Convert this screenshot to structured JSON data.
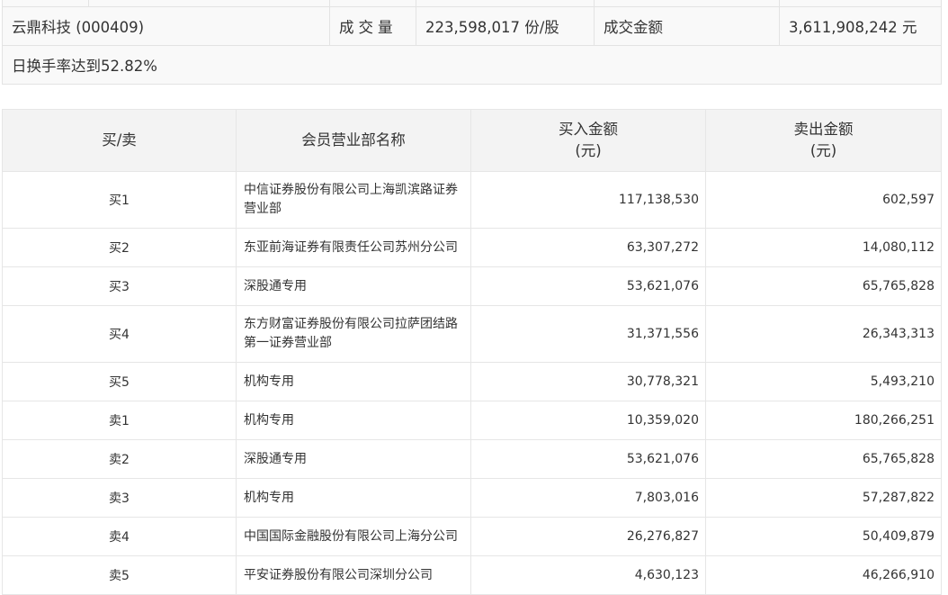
{
  "summary": {
    "stock": "云鼎科技 (000409)",
    "volume_label": "成交量",
    "volume_value": "223,598,017 份/股",
    "amount_label": "成交金额",
    "amount_value": "3,611,908,242 元",
    "note": "日换手率达到52.82%"
  },
  "detail": {
    "headers": {
      "side": "买/卖",
      "name": "会员营业部名称",
      "buy": "买入金额",
      "buy_unit": "(元)",
      "sell": "卖出金额",
      "sell_unit": "(元)"
    },
    "rows": [
      {
        "side": "买1",
        "name": "中信证券股份有限公司上海凯滨路证券营业部",
        "buy": "117,138,530",
        "sell": "602,597"
      },
      {
        "side": "买2",
        "name": "东亚前海证券有限责任公司苏州分公司",
        "buy": "63,307,272",
        "sell": "14,080,112"
      },
      {
        "side": "买3",
        "name": "深股通专用",
        "buy": "53,621,076",
        "sell": "65,765,828"
      },
      {
        "side": "买4",
        "name": "东方财富证券股份有限公司拉萨团结路第一证券营业部",
        "buy": "31,371,556",
        "sell": "26,343,313"
      },
      {
        "side": "买5",
        "name": "机构专用",
        "buy": "30,778,321",
        "sell": "5,493,210"
      },
      {
        "side": "卖1",
        "name": "机构专用",
        "buy": "10,359,020",
        "sell": "180,266,251"
      },
      {
        "side": "卖2",
        "name": "深股通专用",
        "buy": "53,621,076",
        "sell": "65,765,828"
      },
      {
        "side": "卖3",
        "name": "机构专用",
        "buy": "7,803,016",
        "sell": "57,287,822"
      },
      {
        "side": "卖4",
        "name": "中国国际金融股份有限公司上海分公司",
        "buy": "26,276,827",
        "sell": "50,409,879"
      },
      {
        "side": "卖5",
        "name": "平安证券股份有限公司深圳分公司",
        "buy": "4,630,123",
        "sell": "46,266,910"
      }
    ]
  }
}
